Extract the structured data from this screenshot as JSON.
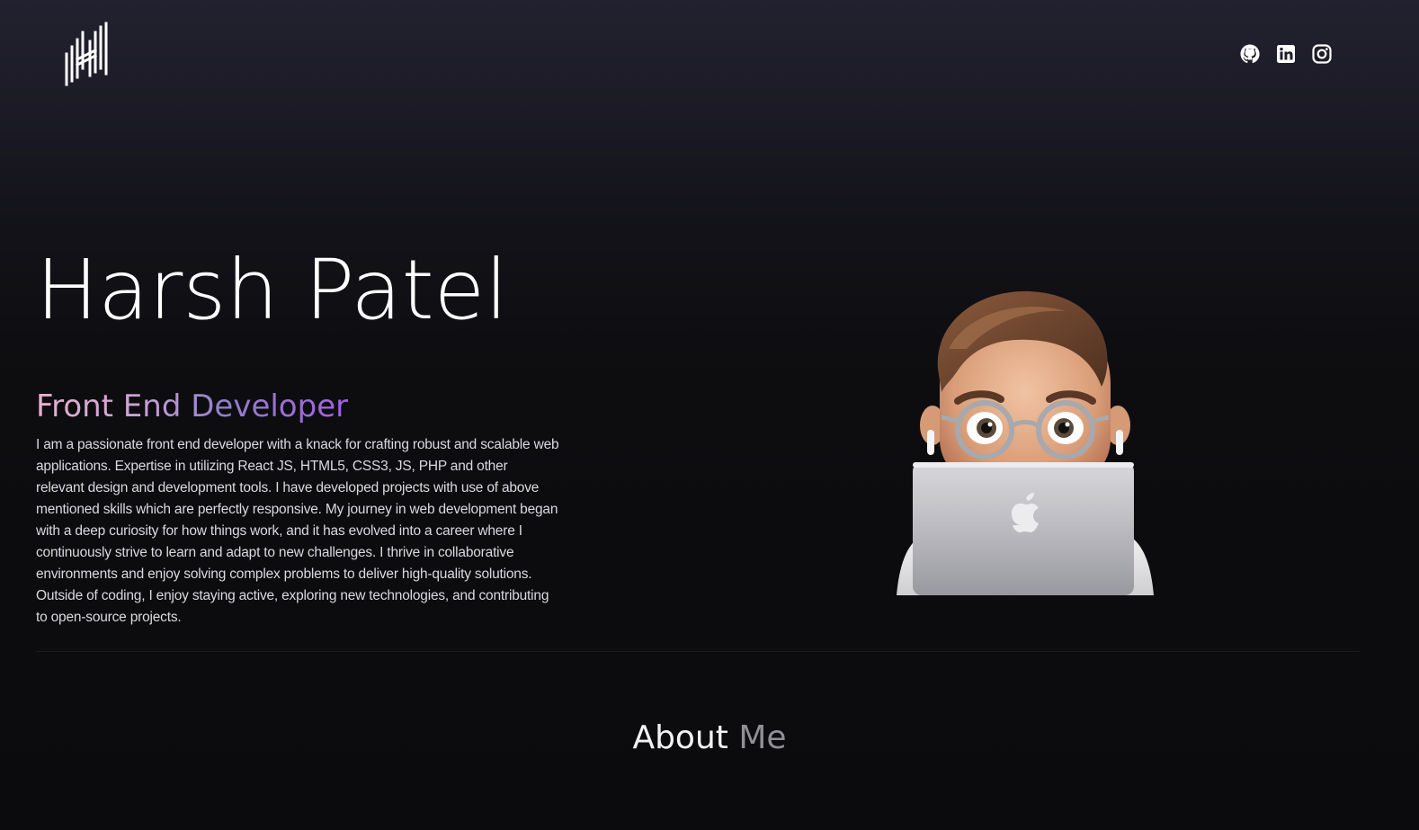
{
  "header": {
    "logo_icon": "monogram-h-logo",
    "social": [
      {
        "name": "GitHub",
        "icon": "github-icon"
      },
      {
        "name": "LinkedIn",
        "icon": "linkedin-icon"
      },
      {
        "name": "Instagram",
        "icon": "instagram-icon"
      }
    ]
  },
  "hero": {
    "name": "Harsh Patel",
    "role": "Front End Developer",
    "bio": "I am a passionate front end developer with a knack for crafting robust and scalable web applications. Expertise in utilizing React JS, HTML5, CSS3, JS, PHP and other relevant design and development tools. I have developed projects with use of above mentioned skills which are perfectly responsive. My journey in web development began with a deep curiosity for how things work, and it has evolved into a career where I continuously strive to learn and adapt to new challenges. I thrive in collaborative environments and enjoy solving complex problems to deliver high-quality solutions. Outside of coding, I enjoy staying active, exploring new technologies, and contributing to open-source projects.",
    "avatar_icon": "memoji-avatar-with-laptop"
  },
  "about": {
    "title_main": "About",
    "title_accent": "Me"
  },
  "colors": {
    "background_top": "#22212f",
    "background_bottom": "#0b0b0d",
    "role_gradient_start": "#e9b1cf",
    "role_gradient_end": "#a560e0",
    "muted_text": "#8f8f96"
  }
}
